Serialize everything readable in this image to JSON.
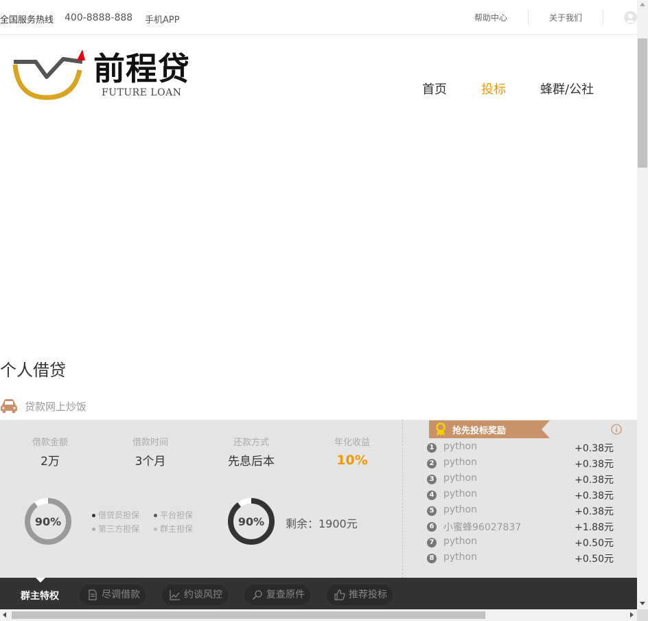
{
  "topbar": {
    "hotline_label": "全国服务热线",
    "hotline_number": "400-8888-888",
    "app_link": "手机APP",
    "help_link": "帮助中心",
    "about_link": "关于我们"
  },
  "header": {
    "logo_text": "前程贷",
    "logo_subtext": "FUTURE LOAN",
    "nav": [
      {
        "label": "首页",
        "active": false
      },
      {
        "label": "投标",
        "active": true
      },
      {
        "label": "蜂群/公社",
        "active": false
      }
    ]
  },
  "loan": {
    "page_title": "个人借贷",
    "loan_name": "贷款网上炒饭",
    "stats": [
      {
        "label": "借款金额",
        "value": "2万"
      },
      {
        "label": "借款时间",
        "value": "3个月"
      },
      {
        "label": "还款方式",
        "value": "先息后本"
      },
      {
        "label": "年化收益",
        "value": "10%"
      }
    ],
    "guarantee_progress": {
      "percent_label": "90%",
      "fraction": 0.9
    },
    "guarantees": [
      {
        "label": "借贷员担保",
        "active": true
      },
      {
        "label": "平台担保",
        "active": true
      },
      {
        "label": "第三方担保",
        "active": false
      },
      {
        "label": "群主担保",
        "active": false
      }
    ],
    "funding_progress": {
      "percent_label": "90%",
      "fraction": 0.9
    },
    "remaining": "剩余：1900元"
  },
  "reward": {
    "title": "抢先投标奖励",
    "rows": [
      {
        "rank": "1",
        "user": "python",
        "amount": "+0.38元"
      },
      {
        "rank": "2",
        "user": "python",
        "amount": "+0.38元"
      },
      {
        "rank": "3",
        "user": "python",
        "amount": "+0.38元"
      },
      {
        "rank": "4",
        "user": "python",
        "amount": "+0.38元"
      },
      {
        "rank": "5",
        "user": "python",
        "amount": "+0.38元"
      },
      {
        "rank": "6",
        "user": "小蜜蜂96027837",
        "amount": "+1.88元"
      },
      {
        "rank": "7",
        "user": "python",
        "amount": "+0.50元"
      },
      {
        "rank": "8",
        "user": "python",
        "amount": "+0.50元"
      }
    ]
  },
  "tabs": {
    "main": "群主特权",
    "items": [
      {
        "label": "尽调借款",
        "icon": "document-icon"
      },
      {
        "label": "约谈风控",
        "icon": "chart-icon"
      },
      {
        "label": "复查原件",
        "icon": "search-icon"
      },
      {
        "label": "推荐投标",
        "icon": "thumbs-up-icon"
      }
    ]
  },
  "colors": {
    "accent": "#f39800",
    "ribbon": "#c8926a",
    "logo_gold": "#d9a520",
    "logo_red": "#e60012",
    "panel_bg": "#e5e5e5",
    "tab_bg": "#333333"
  }
}
